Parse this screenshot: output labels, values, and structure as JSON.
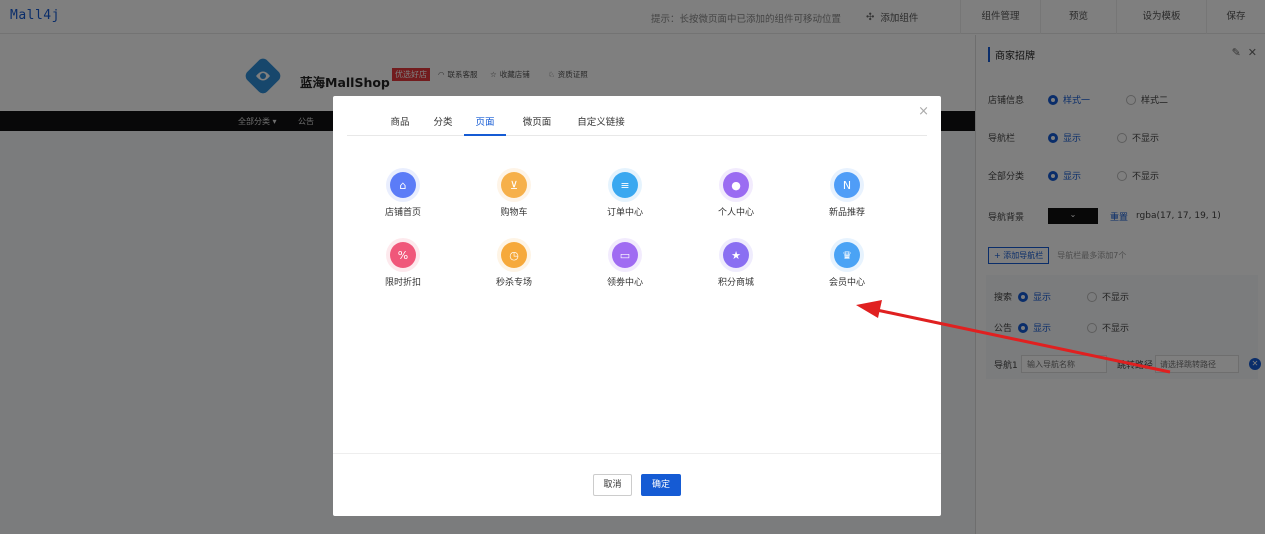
{
  "topbar": {
    "logo": "Mall4j",
    "hint": "提示：长按微页面中已添加的组件可移动位置",
    "add_component": "添加组件",
    "buttons": [
      "组件管理",
      "预览",
      "设为模板",
      "保存"
    ]
  },
  "shop": {
    "name": "蓝海MallShop",
    "badge": "优选好店",
    "links": [
      "联系客服",
      "收藏店铺",
      "资质证照"
    ],
    "nav": [
      "全部分类 ▾",
      "公告"
    ]
  },
  "right_panel": {
    "title": "商家招牌",
    "store_info_label": "店铺信息",
    "style1": "样式一",
    "style2": "样式二",
    "navbar_label": "导航栏",
    "show": "显示",
    "hide": "不显示",
    "all_cat_label": "全部分类",
    "nav_bg_label": "导航背景",
    "reset": "重置",
    "color_value": "rgba(17, 17, 19, 1)",
    "add_nav": "+ 添加导航栏",
    "add_nav_hint": "导航栏最多添加7个",
    "search_label": "搜索",
    "notice_label": "公告",
    "nav1_label": "导航1",
    "nav1_placeholder": "输入导航名称",
    "jump_label": "跳转路径",
    "jump_placeholder": "请选择跳转路径"
  },
  "dialog": {
    "tabs": [
      "商品",
      "分类",
      "页面",
      "微页面",
      "自定义链接"
    ],
    "active_tab": "页面",
    "items": [
      {
        "label": "店铺首页",
        "icon": "home-icon",
        "color": "#5b7cf7",
        "glyph": "⌂"
      },
      {
        "label": "购物车",
        "icon": "cart-icon",
        "color": "#f6b04a",
        "glyph": "⊻"
      },
      {
        "label": "订单中心",
        "icon": "order-icon",
        "color": "#3aa8f0",
        "glyph": "≡"
      },
      {
        "label": "个人中心",
        "icon": "user-icon",
        "color": "#9b6cf2",
        "glyph": "●"
      },
      {
        "label": "新品推荐",
        "icon": "new-icon",
        "color": "#4f9df7",
        "glyph": "N"
      },
      {
        "label": "限时折扣",
        "icon": "discount-icon",
        "color": "#f0577a",
        "glyph": "%"
      },
      {
        "label": "秒杀专场",
        "icon": "seckill-icon",
        "color": "#f6a93b",
        "glyph": "◷"
      },
      {
        "label": "领劵中心",
        "icon": "coupon-icon",
        "color": "#a06cf2",
        "glyph": "▭"
      },
      {
        "label": "积分商城",
        "icon": "points-icon",
        "color": "#8a6ff2",
        "glyph": "★"
      },
      {
        "label": "会员中心",
        "icon": "vip-icon",
        "color": "#4aa3f5",
        "glyph": "♛"
      }
    ],
    "cancel": "取消",
    "ok": "确定"
  }
}
